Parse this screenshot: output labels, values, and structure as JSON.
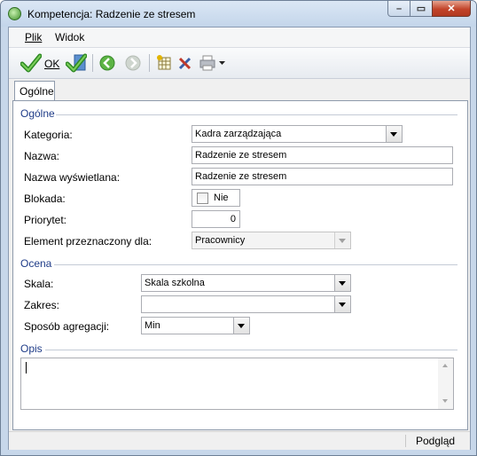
{
  "window": {
    "title": "Kompetencja: Radzenie ze stresem",
    "minimize": "–",
    "maximize": "▭",
    "close": "✕"
  },
  "menu": [
    {
      "label": "Plik"
    },
    {
      "label": "Widok"
    }
  ],
  "toolbar": {
    "ok_label": "OK"
  },
  "tabs": [
    {
      "label": "Ogólne",
      "active": true
    }
  ],
  "sections": {
    "ogolne": {
      "title": "Ogólne",
      "kategoria": {
        "label": "Kategoria:",
        "value": "Kadra zarządzająca"
      },
      "nazwa": {
        "label": "Nazwa:",
        "value": "Radzenie ze stresem"
      },
      "nazwa_wyswietlana": {
        "label": "Nazwa wyświetlana:",
        "value": "Radzenie ze stresem"
      },
      "blokada": {
        "label": "Blokada:",
        "checkbox_label": "Nie",
        "checked": false
      },
      "priorytet": {
        "label": "Priorytet:",
        "value": "0"
      },
      "element": {
        "label": "Element przeznaczony dla:",
        "value": "Pracownicy"
      }
    },
    "ocena": {
      "title": "Ocena",
      "skala": {
        "label": "Skala:",
        "value": "Skala szkolna"
      },
      "zakres": {
        "label": "Zakres:",
        "value": ""
      },
      "sposob": {
        "label": "Sposób agregacji:",
        "value": "Min"
      }
    },
    "opis": {
      "title": "Opis",
      "value": ""
    }
  },
  "status": {
    "text": "Podgląd"
  },
  "colors": {
    "section_title": "#1f3c88",
    "ok_green": "#3fa535"
  }
}
